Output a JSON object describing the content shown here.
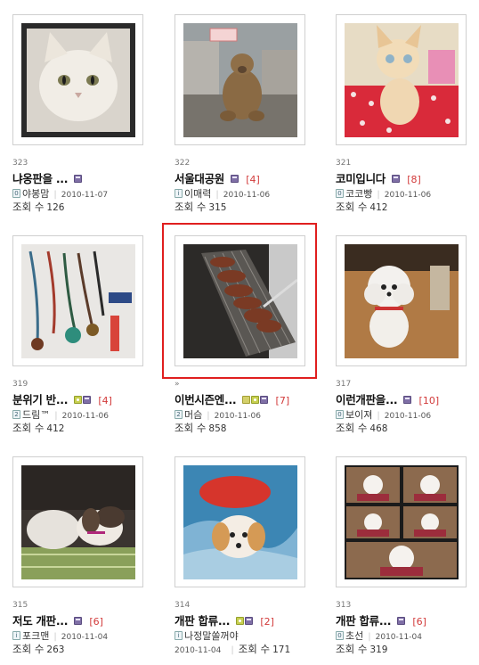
{
  "items": [
    {
      "num": "323",
      "title": "냐옹판을 ...",
      "comments": "",
      "author": "야봉맘",
      "date": "2010-11-07",
      "views_label": "조회 수",
      "views": "126"
    },
    {
      "num": "322",
      "title": "서울대공원",
      "comments": "[4]",
      "author": "이매력",
      "date": "2010-11-06",
      "views_label": "조회 수",
      "views": "315"
    },
    {
      "num": "321",
      "title": "코미입니다",
      "comments": "[8]",
      "author": "코코빵",
      "date": "2010-11-06",
      "views_label": "조회 수",
      "views": "412"
    },
    {
      "num": "319",
      "title": "분위기 반...",
      "comments": "[4]",
      "author": "드림™",
      "date": "2010-11-06",
      "views_label": "조회 수",
      "views": "412"
    },
    {
      "num": "»",
      "title": "이번시즌엔...",
      "comments": "[7]",
      "author": "머슴",
      "date": "2010-11-06",
      "views_label": "조회 수",
      "views": "858"
    },
    {
      "num": "317",
      "title": "이런개판을...",
      "comments": "[10]",
      "author": "보이져",
      "date": "2010-11-06",
      "views_label": "조회 수",
      "views": "468"
    },
    {
      "num": "315",
      "title": "저도 개판...",
      "comments": "[6]",
      "author": "포크맨",
      "date": "2010-11-04",
      "views_label": "조회 수",
      "views": "263"
    },
    {
      "num": "314",
      "title": "개판 합류...",
      "comments": "[2]",
      "author": "나정말쏠꺼야",
      "date": "2010-11-04",
      "views_label": "조회 수",
      "views": "171"
    },
    {
      "num": "313",
      "title": "개판 합류...",
      "comments": "[6]",
      "author": "초선",
      "date": "2010-11-04",
      "views_label": "조회 수",
      "views": "319"
    }
  ],
  "selected_index": 4,
  "colors": {
    "selection": "#e01f1f",
    "comments": "#d23a3a"
  },
  "icons": [
    "photo-icon",
    "save-icon",
    "new-icon",
    "level-icon"
  ]
}
